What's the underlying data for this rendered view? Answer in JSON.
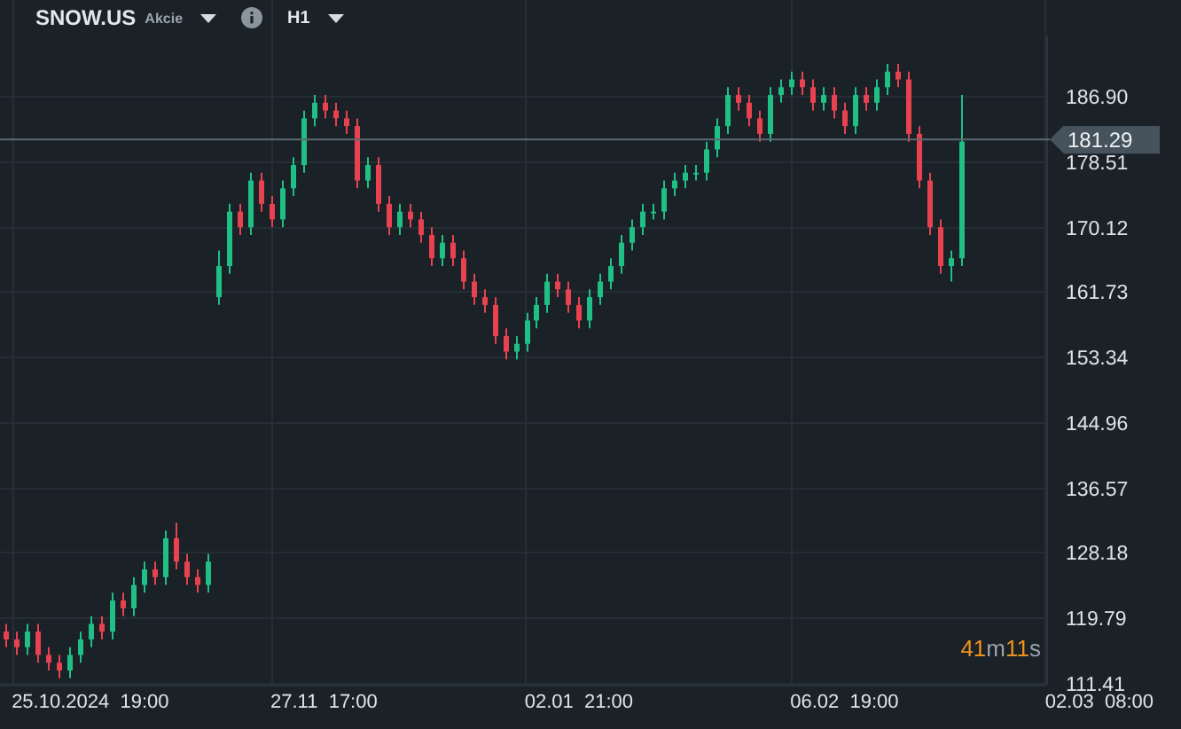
{
  "header": {
    "symbol": "SNOW.US",
    "instrument_type": "Akcie",
    "timeframe": "H1"
  },
  "chart_data": {
    "type": "candlestick",
    "grid": true,
    "categories": [
      null,
      null,
      null,
      null,
      null,
      null,
      null,
      null,
      "25.10.2024  19:00",
      null,
      null,
      null,
      null,
      null,
      null,
      null,
      null,
      null,
      null,
      null,
      null,
      null,
      null,
      null,
      null,
      null,
      null,
      null,
      null,
      null,
      "27.11  17:00",
      null,
      null,
      null,
      null,
      null,
      null,
      null,
      null,
      null,
      null,
      null,
      null,
      null,
      null,
      null,
      null,
      null,
      null,
      null,
      null,
      null,
      null,
      null,
      "02.01  21:00",
      null,
      null,
      null,
      null,
      null,
      null,
      null,
      null,
      null,
      null,
      null,
      null,
      null,
      null,
      null,
      null,
      null,
      null,
      null,
      null,
      null,
      null,
      null,
      null,
      "06.02  19:00",
      null,
      null,
      null,
      null,
      null,
      null,
      null,
      null,
      null,
      null,
      null,
      null,
      null,
      null,
      null,
      null,
      null,
      null,
      null,
      null,
      null,
      null,
      null,
      "02.03  08:00"
    ],
    "ohlc": [
      [
        118,
        119,
        116,
        117
      ],
      [
        117,
        118,
        115,
        116
      ],
      [
        116,
        119,
        115,
        118
      ],
      [
        118,
        119,
        114,
        115
      ],
      [
        115,
        116,
        113,
        114
      ],
      [
        114,
        115,
        112,
        113
      ],
      [
        113,
        116,
        112,
        115
      ],
      [
        115,
        118,
        114,
        117
      ],
      [
        117,
        120,
        116,
        119
      ],
      [
        119,
        120,
        117,
        118
      ],
      [
        118,
        123,
        117,
        122
      ],
      [
        122,
        123,
        120,
        121
      ],
      [
        121,
        125,
        120,
        124
      ],
      [
        124,
        127,
        123,
        126
      ],
      [
        126,
        127,
        124,
        125
      ],
      [
        125,
        131,
        124,
        130
      ],
      [
        130,
        132,
        126,
        127
      ],
      [
        127,
        128,
        124,
        125
      ],
      [
        125,
        126,
        123,
        124
      ],
      [
        124,
        128,
        123,
        127
      ],
      [
        161,
        167,
        160,
        165
      ],
      [
        165,
        173,
        164,
        172
      ],
      [
        172,
        173,
        169,
        170
      ],
      [
        170,
        177,
        169,
        176
      ],
      [
        176,
        177,
        172,
        173
      ],
      [
        173,
        174,
        170,
        171
      ],
      [
        171,
        176,
        170,
        175
      ],
      [
        175,
        179,
        174,
        178
      ],
      [
        178,
        185,
        177,
        184
      ],
      [
        184,
        187,
        183,
        186
      ],
      [
        186,
        187,
        184,
        185
      ],
      [
        185,
        186,
        183,
        184
      ],
      [
        184,
        185,
        182,
        183
      ],
      [
        183,
        184,
        175,
        176
      ],
      [
        176,
        179,
        175,
        178
      ],
      [
        178,
        179,
        172,
        173
      ],
      [
        173,
        174,
        169,
        170
      ],
      [
        170,
        173,
        169,
        172
      ],
      [
        172,
        173,
        170,
        171
      ],
      [
        171,
        172,
        168,
        169
      ],
      [
        169,
        170,
        165,
        166
      ],
      [
        166,
        169,
        165,
        168
      ],
      [
        168,
        169,
        165,
        166
      ],
      [
        166,
        167,
        162,
        163
      ],
      [
        163,
        164,
        160,
        161
      ],
      [
        161,
        162,
        159,
        160
      ],
      [
        160,
        161,
        155,
        156
      ],
      [
        156,
        157,
        153,
        154
      ],
      [
        154,
        156,
        153,
        155
      ],
      [
        155,
        159,
        154,
        158
      ],
      [
        158,
        161,
        157,
        160
      ],
      [
        160,
        164,
        159,
        163
      ],
      [
        163,
        164,
        161,
        162
      ],
      [
        162,
        163,
        159,
        160
      ],
      [
        160,
        161,
        157,
        158
      ],
      [
        158,
        162,
        157,
        161
      ],
      [
        161,
        164,
        160,
        163
      ],
      [
        163,
        166,
        162,
        165
      ],
      [
        165,
        169,
        164,
        168
      ],
      [
        168,
        171,
        167,
        170
      ],
      [
        170,
        173,
        169,
        172
      ],
      [
        172,
        173,
        171,
        172
      ],
      [
        172,
        176,
        171,
        175
      ],
      [
        175,
        177,
        174,
        176
      ],
      [
        176,
        178,
        175,
        177
      ],
      [
        177,
        178,
        176,
        177
      ],
      [
        177,
        181,
        176,
        180
      ],
      [
        180,
        184,
        179,
        183
      ],
      [
        183,
        188,
        182,
        187
      ],
      [
        187,
        188,
        185,
        186
      ],
      [
        186,
        187,
        183,
        184
      ],
      [
        184,
        185,
        181,
        182
      ],
      [
        182,
        188,
        181,
        187
      ],
      [
        187,
        189,
        186,
        188
      ],
      [
        188,
        190,
        187,
        189
      ],
      [
        189,
        190,
        187,
        188
      ],
      [
        188,
        189,
        185,
        186
      ],
      [
        186,
        188,
        185,
        187
      ],
      [
        187,
        188,
        184,
        185
      ],
      [
        185,
        186,
        182,
        183
      ],
      [
        183,
        188,
        182,
        187
      ],
      [
        187,
        188,
        185,
        186
      ],
      [
        186,
        189,
        185,
        188
      ],
      [
        188,
        191,
        187,
        190
      ],
      [
        190,
        191,
        188,
        189
      ],
      [
        189,
        190,
        181,
        182
      ],
      [
        182,
        183,
        175,
        176
      ],
      [
        176,
        177,
        169,
        170
      ],
      [
        170,
        171,
        164,
        165
      ],
      [
        165,
        167,
        163,
        166
      ],
      [
        166,
        187,
        165,
        181
      ],
      null,
      null,
      null,
      null,
      null,
      null,
      null,
      null,
      null,
      null,
      null,
      null,
      null
    ],
    "yticks": [
      {
        "value": 186.9,
        "label": "186.90"
      },
      {
        "value": 178.51,
        "label": "178.51"
      },
      {
        "value": 170.12,
        "label": "170.12"
      },
      {
        "value": 161.73,
        "label": "161.73"
      },
      {
        "value": 153.34,
        "label": "153.34"
      },
      {
        "value": 144.96,
        "label": "144.96"
      },
      {
        "value": 136.57,
        "label": "136.57"
      },
      {
        "value": 128.18,
        "label": "128.18"
      },
      {
        "value": 119.79,
        "label": "119.79"
      },
      {
        "value": 111.41,
        "label": "111.41"
      }
    ],
    "ylim": [
      111.18,
      194.65
    ],
    "ref_lines": [
      {
        "axis": "y",
        "value": 181.29,
        "label": "181.29"
      }
    ]
  },
  "countdown": [
    {
      "text": "41",
      "kind": "number"
    },
    {
      "text": "m",
      "kind": "unit"
    },
    {
      "text": "11",
      "kind": "number"
    },
    {
      "text": "s",
      "kind": "unit"
    }
  ]
}
